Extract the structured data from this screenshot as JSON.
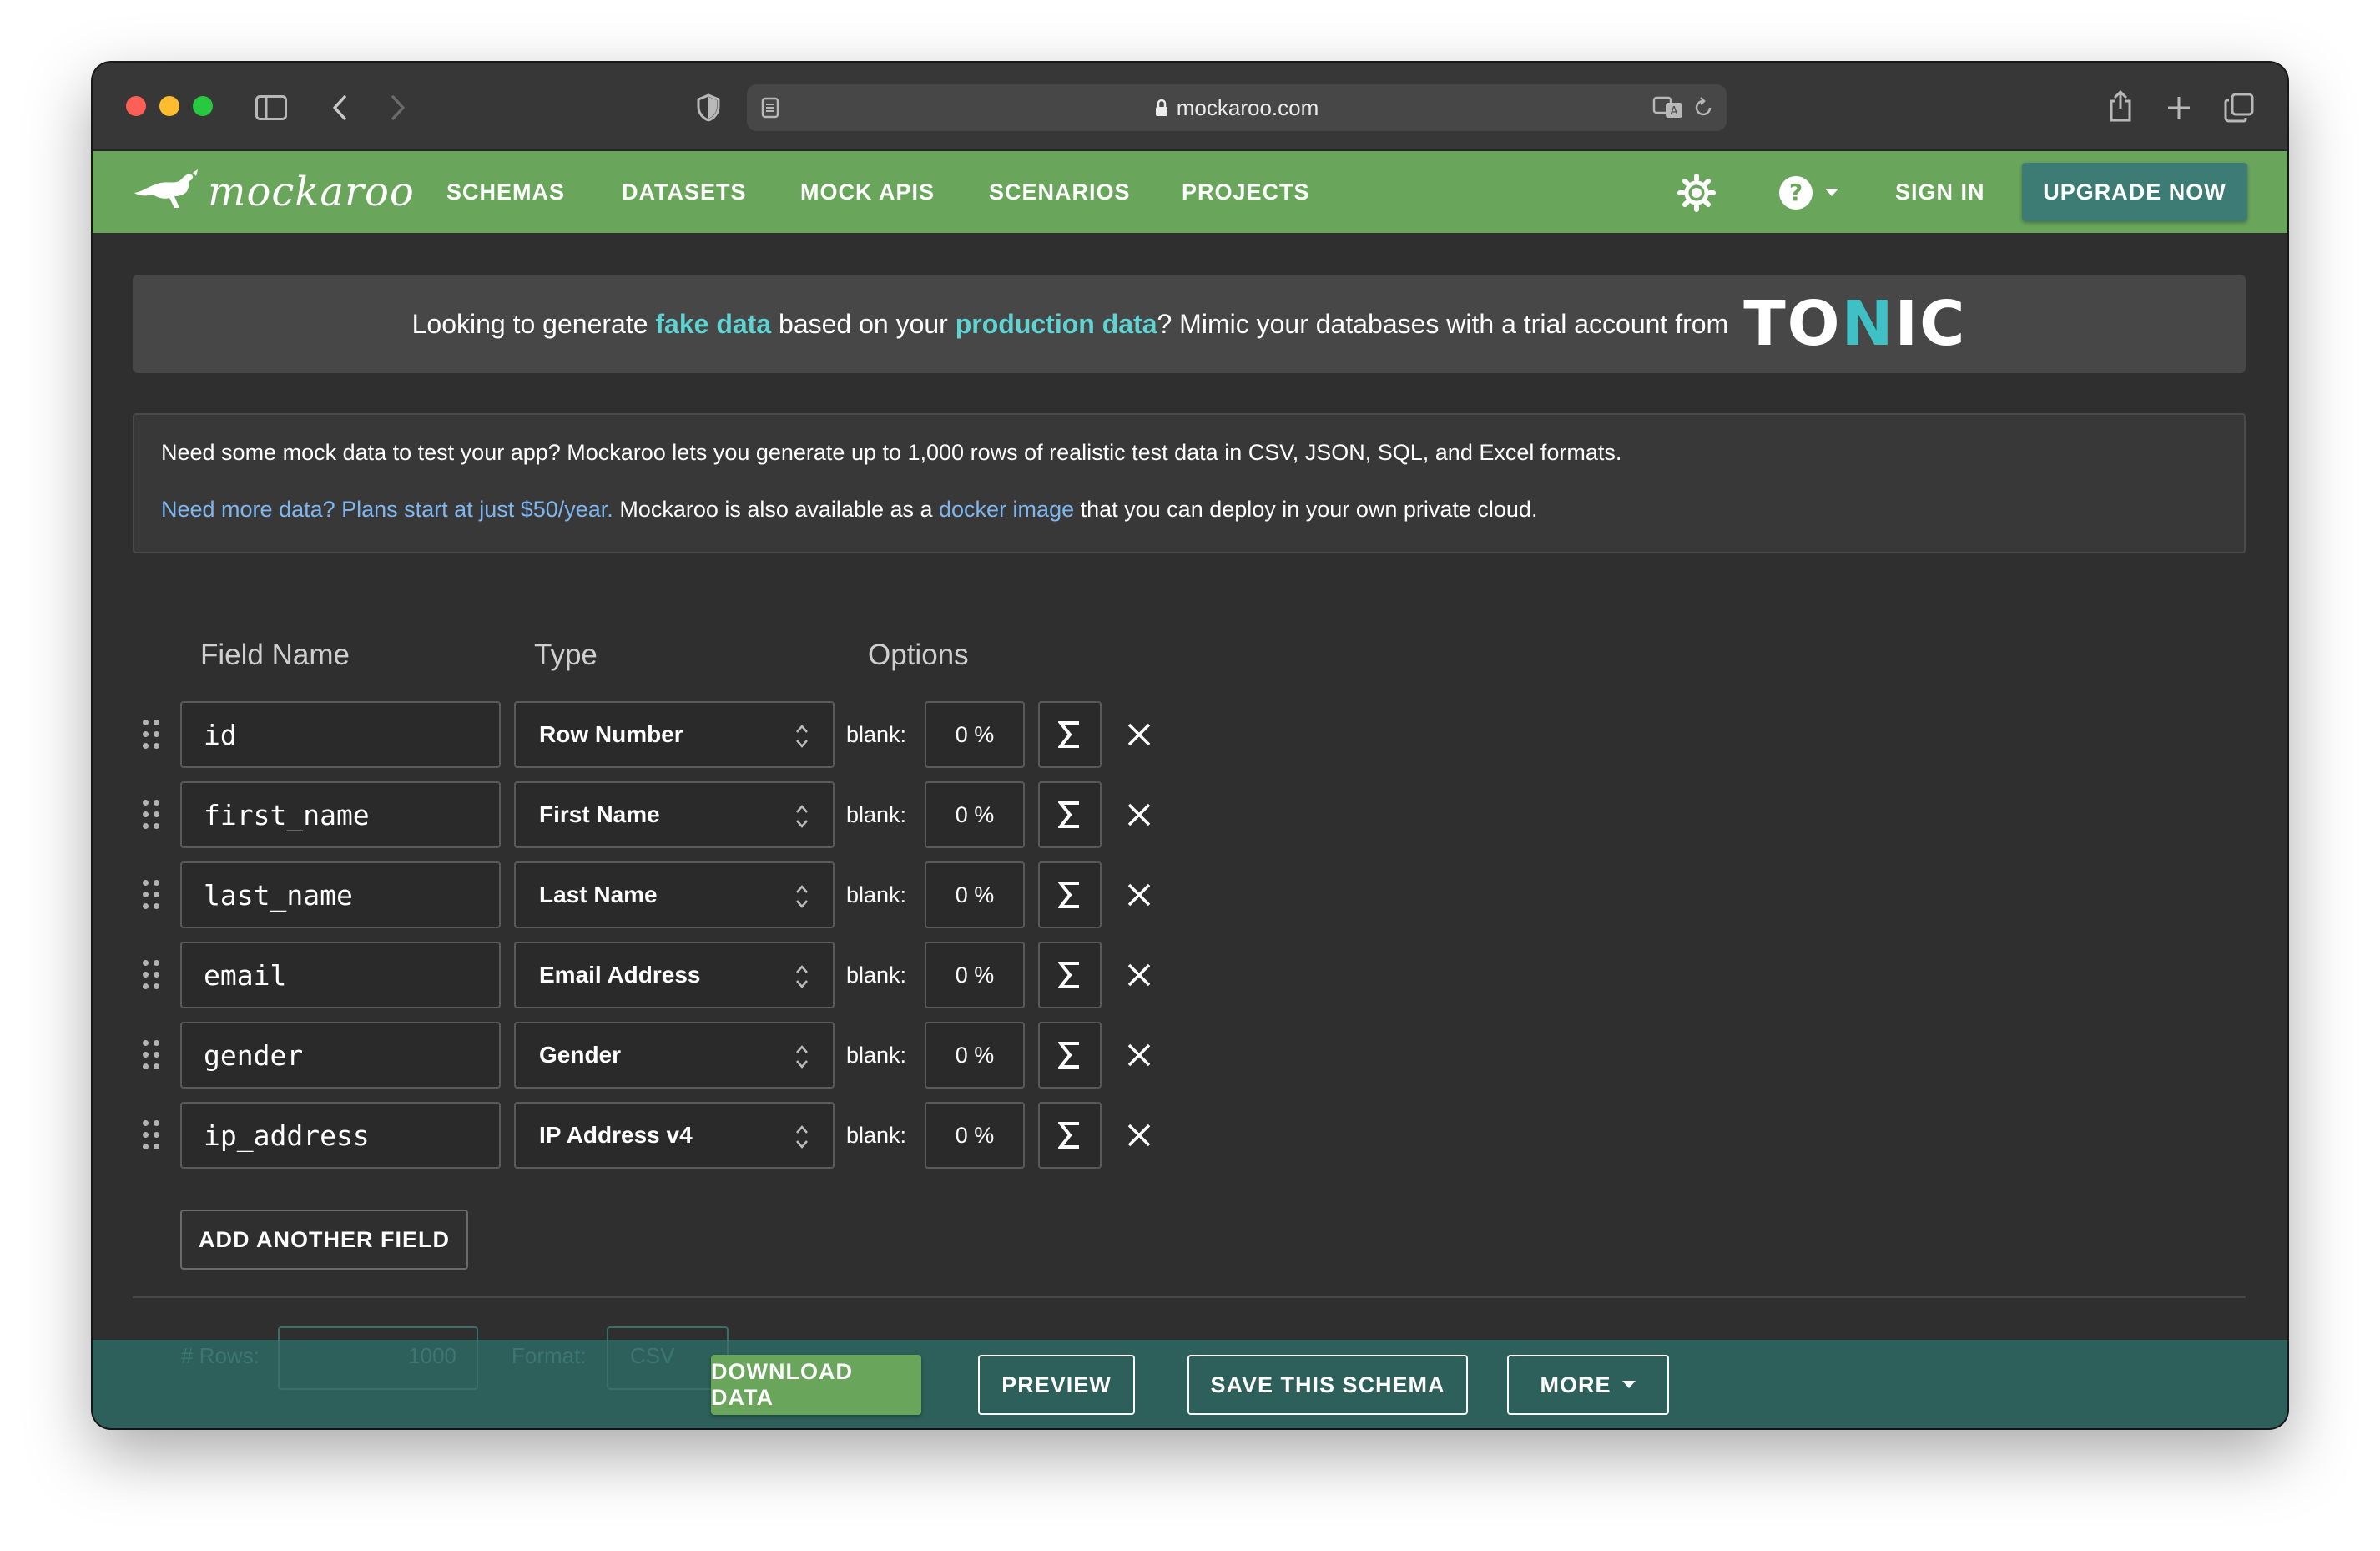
{
  "browser": {
    "url": "mockaroo.com"
  },
  "nav": {
    "brand": "mockaroo",
    "links": [
      "SCHEMAS",
      "DATASETS",
      "MOCK APIS",
      "SCENARIOS",
      "PROJECTS"
    ],
    "sign_in": "SIGN IN",
    "upgrade": "UPGRADE NOW"
  },
  "banner": {
    "t1": "Looking to generate ",
    "hl1": "fake data",
    "t2": " based on your ",
    "hl2": "production data",
    "t3": "? Mimic your databases with a trial account from",
    "logo_a": "TO",
    "logo_n": "N",
    "logo_b": "IC"
  },
  "info": {
    "line1": "Need some mock data to test your app? Mockaroo lets you generate up to 1,000 rows of realistic test data in CSV, JSON, SQL, and Excel formats.",
    "link1": "Need more data? Plans start at just $50/year.",
    "t2": " Mockaroo is also available as a ",
    "link2": "docker image",
    "t3": " that you can deploy in your own private cloud."
  },
  "table": {
    "headers": {
      "field_name": "Field Name",
      "type": "Type",
      "options": "Options"
    },
    "blank_label": "blank:",
    "rows": [
      {
        "name": "id",
        "type": "Row Number",
        "blank": "0 %"
      },
      {
        "name": "first_name",
        "type": "First Name",
        "blank": "0 %"
      },
      {
        "name": "last_name",
        "type": "Last Name",
        "blank": "0 %"
      },
      {
        "name": "email",
        "type": "Email Address",
        "blank": "0 %"
      },
      {
        "name": "gender",
        "type": "Gender",
        "blank": "0 %"
      },
      {
        "name": "ip_address",
        "type": "IP Address v4",
        "blank": "0 %"
      }
    ],
    "add_field": "ADD ANOTHER FIELD"
  },
  "footer": {
    "rows_label": "# Rows:",
    "rows_value": "1000",
    "format_label": "Format:",
    "format_value": "CSV",
    "download": "DOWNLOAD DATA",
    "preview": "PREVIEW",
    "save": "SAVE THIS SCHEMA",
    "more": "MORE"
  },
  "colors": {
    "nav_green": "#69a55a",
    "accent_teal": "#3d7c74",
    "footer_teal": "#2d5f5b",
    "link_blue": "#7fb6ef",
    "highlight_cyan": "#5fd4d2"
  },
  "icons": [
    "sidebar-icon",
    "back-icon",
    "forward-icon",
    "shield-icon",
    "reader-icon",
    "lock-icon",
    "translate-icon",
    "reload-icon",
    "share-icon",
    "new-tab-icon",
    "tabs-icon",
    "kangaroo-icon",
    "theme-icon",
    "help-icon",
    "drag-handle-icon",
    "sort-chevrons-icon",
    "sigma-icon",
    "close-icon",
    "caret-down-icon"
  ]
}
